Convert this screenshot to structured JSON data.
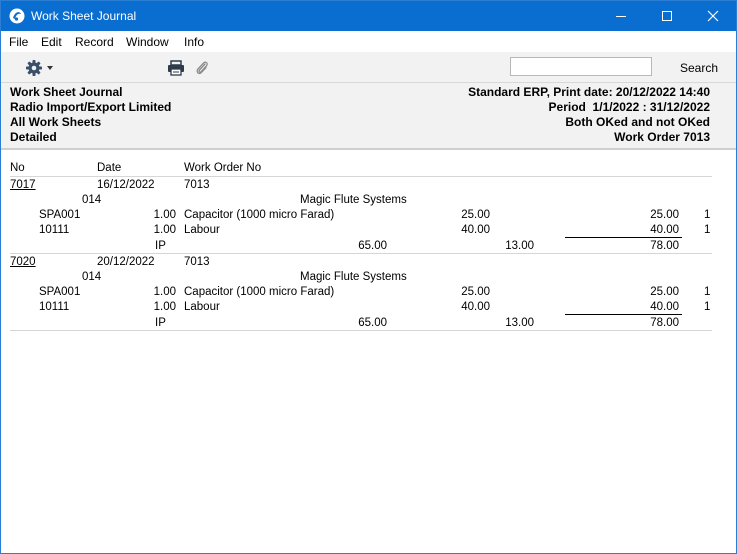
{
  "window": {
    "title": "Work Sheet Journal"
  },
  "menu": [
    "File",
    "Edit",
    "Record",
    "Window",
    "Info"
  ],
  "toolbar": {
    "search_label": "Search",
    "search_value": ""
  },
  "header": {
    "left": [
      "Work Sheet Journal",
      "Radio Import/Export Limited",
      "All Work Sheets",
      "Detailed"
    ],
    "right": [
      "Standard ERP, Print date: 20/12/2022 14:40",
      "Period  1/1/2022 : 31/12/2022",
      "Both OKed and not OKed",
      "Work Order 7013"
    ]
  },
  "columns": {
    "no": "No",
    "date": "Date",
    "work_order_no": "Work Order No"
  },
  "records": [
    {
      "no": "7017",
      "date": "16/12/2022",
      "work_order": "7013",
      "customer_code": "014",
      "customer_name": "Magic Flute Systems",
      "rows": [
        {
          "item": "SPA001",
          "qty": "1.00",
          "desc": "Capacitor (1000 micro Farad)",
          "price": "25.00",
          "sum": "25.00",
          "flag": "1"
        },
        {
          "item": "10111",
          "qty": "1.00",
          "desc": "Labour",
          "price": "40.00",
          "sum": "40.00",
          "flag": "1"
        }
      ],
      "total": {
        "code": "IP",
        "amount": "65.00",
        "vat": "13.00",
        "total": "78.00"
      }
    },
    {
      "no": "7020",
      "date": "20/12/2022",
      "work_order": "7013",
      "customer_code": "014",
      "customer_name": "Magic Flute Systems",
      "rows": [
        {
          "item": "SPA001",
          "qty": "1.00",
          "desc": "Capacitor (1000 micro Farad)",
          "price": "25.00",
          "sum": "25.00",
          "flag": "1"
        },
        {
          "item": "10111",
          "qty": "1.00",
          "desc": "Labour",
          "price": "40.00",
          "sum": "40.00",
          "flag": "1"
        }
      ],
      "total": {
        "code": "IP",
        "amount": "65.00",
        "vat": "13.00",
        "total": "78.00"
      }
    }
  ],
  "colors": {
    "titlebar": "#0a6ed1",
    "toolbar_bg": "#f2f2f2",
    "header_bg": "#f2f2f2"
  }
}
